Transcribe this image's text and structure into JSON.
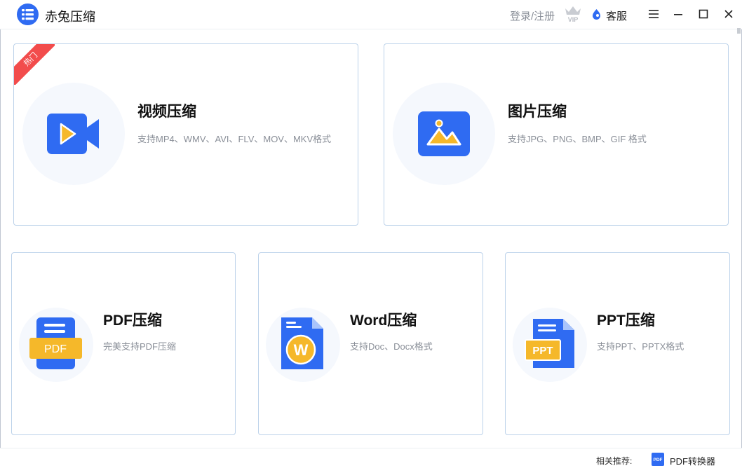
{
  "app": {
    "title": "赤兔压缩"
  },
  "header": {
    "login": "登录/注册",
    "vip_label": "VIP",
    "service": "客服"
  },
  "cards": [
    {
      "title": "视频压缩",
      "desc": "支持MP4、WMV、AVI、FLV、MOV、MKV格式",
      "badge": "热门",
      "icon": "video-icon"
    },
    {
      "title": "图片压缩",
      "desc": "支持JPG、PNG、BMP、GIF 格式",
      "icon": "image-icon"
    },
    {
      "title": "PDF压缩",
      "desc": "完美支持PDF压缩",
      "icon": "pdf-file-icon",
      "icon_text": "PDF"
    },
    {
      "title": "Word压缩",
      "desc": "支持Doc、Docx格式",
      "icon": "word-file-icon",
      "icon_text": "W"
    },
    {
      "title": "PPT压缩",
      "desc": "支持PPT、PPTX格式",
      "icon": "ppt-file-icon",
      "icon_text": "PPT"
    }
  ],
  "footer": {
    "recommend_label": "相关推荐:",
    "pdf_icon_text": "PDF",
    "link": "PDF转换器"
  },
  "colors": {
    "brand_blue": "#2f6bf2",
    "accent_yellow": "#f5b82a",
    "badge_red": "#f24c4c",
    "card_border": "#bcd2ea"
  }
}
